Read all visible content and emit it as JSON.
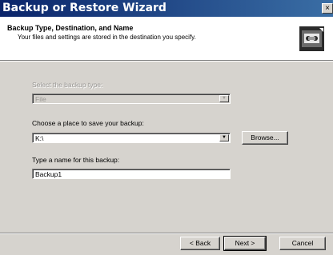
{
  "window": {
    "title": "Backup or Restore Wizard",
    "close_glyph": "×"
  },
  "header": {
    "title": "Backup Type, Destination, and Name",
    "subtitle": "Your files and settings are stored in the destination you specify.",
    "icon": "backup-wizard-icon"
  },
  "form": {
    "backup_type_label": "Select the backup type:",
    "backup_type_value": "File",
    "location_label": "Choose a place to save your backup:",
    "location_value": "K:\\",
    "browse_label": "Browse...",
    "name_label": "Type a name for this backup:",
    "name_value": "Backup1"
  },
  "footer": {
    "back_label": "< Back",
    "next_label": "Next >",
    "cancel_label": "Cancel"
  }
}
